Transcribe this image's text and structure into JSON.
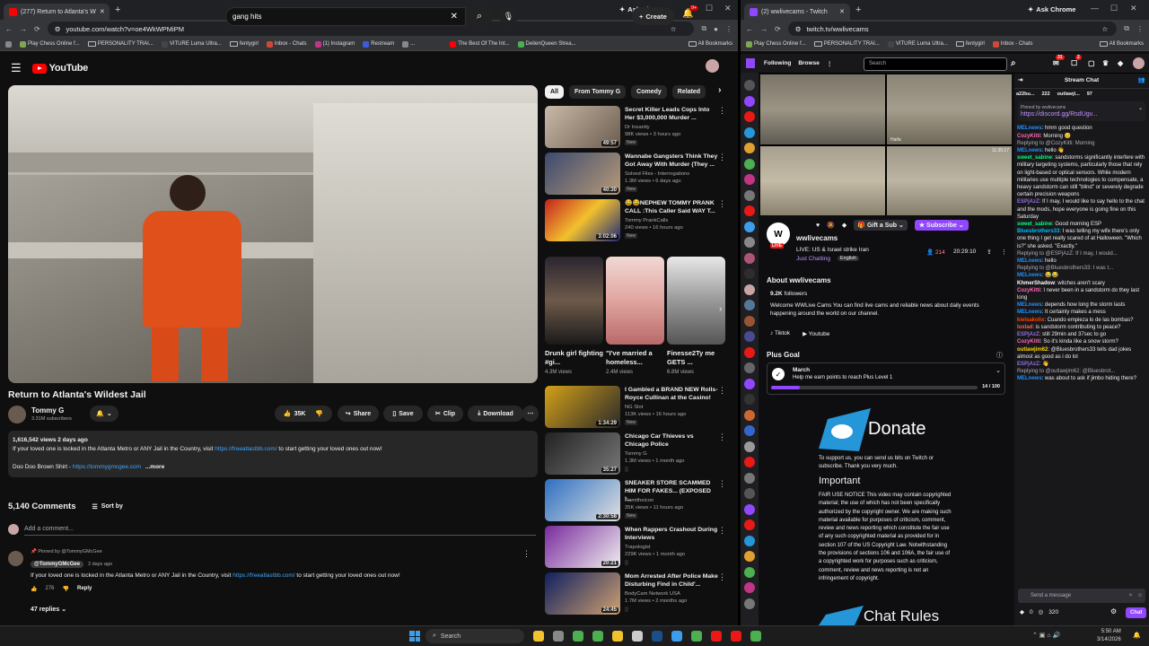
{
  "left_window": {
    "tab_title": "(277) Return to Atlanta's W",
    "url": "youtube.com/watch?v=oe4WkWPMiPM",
    "ask_chrome": "Ask Chrome",
    "bookmarks": [
      "Play Chess Online f...",
      "PERSONALITY TRAI...",
      "VITURE Luma Ultra...",
      "fentygirl",
      "Inbox - Chats",
      "(1) Instagram",
      "Restream",
      "...",
      "The Best Of The Int...",
      "DeilenQueen Strea...",
      "All Bookmarks"
    ]
  },
  "youtube": {
    "logo": "YouTube",
    "search_value": "gang hits",
    "create_label": "Create",
    "notif_count": "9+",
    "video_title": "Return to Atlanta's Wildest Jail",
    "channel_name": "Tommy G",
    "subscribers": "3.31M subscribers",
    "likes": "35K",
    "share": "Share",
    "save": "Save",
    "clip": "Clip",
    "download": "Download",
    "views_date": "1,616,542 views  2 days ago",
    "desc_line1_a": "If your loved one is locked in the Atlanta Metro or ANY Jail in the Country, visit ",
    "desc_link1": "https://freeatlastbb.com/",
    "desc_line1_b": " to start getting your loved ones out now!",
    "desc_line2_a": "Doo Doo Brown Shirt - ",
    "desc_link2": "https://tommygmcgee.com",
    "desc_more": "...more",
    "comments_count": "5,140 Comments",
    "sort_by": "Sort by",
    "add_comment": "Add a comment...",
    "pinned_by": "Pinned by @TommyGMcGee",
    "comment_author": "@TommyGMcGee",
    "comment_time": "2 days ago",
    "comment_text_a": "If your loved one is locked in the Atlanta Metro or ANY Jail in the Country, visit ",
    "comment_link": "https://freeatlastbb.com/",
    "comment_text_b": " to start getting your loved ones out now!",
    "comment_likes": "276",
    "reply": "Reply",
    "replies": "47 replies",
    "chips": [
      "All",
      "From Tommy G",
      "Comedy",
      "Related"
    ],
    "recs": [
      {
        "title": "Secret Killer Leads Cops Into Her $3,000,000 Murder ...",
        "channel": "Dr Insanity",
        "meta": "98K views • 3 hours ago",
        "duration": "49:57",
        "isnew": "New"
      },
      {
        "title": "Wannabe Gangsters Think They Got Away With Murder (They ...",
        "channel": "Solved Files - Interrogations",
        "meta": "1.3M views • 6 days ago",
        "duration": "40:30",
        "isnew": "New"
      },
      {
        "title": "😂😂NEPHEW TOMMY PRANK CALL :This Caller Said WAY T...",
        "channel": "Tommy PrankCalls",
        "meta": "240 views • 16 hours ago",
        "duration": "3:02:06",
        "isnew": "New"
      }
    ],
    "shorts": [
      {
        "title": "Drunk girl fighting #gi...",
        "views": "4.3M views"
      },
      {
        "title": "\"I've married a homeless...",
        "views": "2.4M views"
      },
      {
        "title": "Finesse2Ty me GETS ...",
        "views": "6.8M views"
      }
    ],
    "recs2": [
      {
        "title": "I Gambled a BRAND NEW Rolls-Royce Cullinan at the Casino!",
        "channel": "NG Slot",
        "meta": "113K views • 16 hours ago",
        "duration": "1:34:29",
        "isnew": "New"
      },
      {
        "title": "Chicago Car Thieves vs Chicago Police",
        "channel": "Tommy G",
        "meta": "1.3M views • 1 month ago",
        "duration": "35:27",
        "isnew": ""
      },
      {
        "title": "SNEAKER STORE SCAMMED HIM FOR FAKES... (EXPOSED I...",
        "channel": "Ramitheicon",
        "meta": "35K views • 11 hours ago",
        "duration": "2:30:58",
        "isnew": "New"
      },
      {
        "title": "When Rappers Crashout During Interviews",
        "channel": "Trapologist",
        "meta": "229K views • 1 month ago",
        "duration": "20:21",
        "isnew": ""
      },
      {
        "title": "Mom Arrested After Police Make Disturbing Find in Child'...",
        "channel": "BodyCam Network USA",
        "meta": "1.7M views • 2 months ago",
        "duration": "24:45",
        "isnew": ""
      }
    ]
  },
  "right_window": {
    "tab_title": "(2) wwlivecams - Twitch",
    "url": "twitch.tv/wwlivecams",
    "ask_chrome": "Ask Chrome",
    "bookmarks": [
      "Play Chess Online f...",
      "PERSONALITY TRAI...",
      "VITURE Luma Ultra...",
      "fentygirl",
      "Inbox - Chats",
      "All Bookmarks"
    ]
  },
  "twitch": {
    "following": "Following",
    "browse": "Browse",
    "search_placeholder": "Search",
    "notif1": "31",
    "notif2": "2",
    "cam_labels": [
      "",
      "Haifa",
      "",
      "11:35:17"
    ],
    "gift": "Gift a Sub",
    "subscribe": "Subscribe",
    "channel": "wwlivecams",
    "live": "LIVE",
    "stream_title": "LIVE: US & Israel strike Iran",
    "category": "Just Chatting",
    "language": "English",
    "viewers": "214",
    "uptime": "20:29:10",
    "about": "About wwlivecams",
    "followers": "9.2K",
    "followers_label": "followers",
    "about_text": "Welcome WWLive Cams You can find live cams and reliable news about daily events happening around the world on our channel.",
    "tiktok": "Tiktok",
    "youtube": "Youtube",
    "plus_goal": "Plus Goal",
    "goal_month": "March",
    "goal_text": "Help me earn points to reach Plus Level 1",
    "goal_progress": "14 / 100",
    "donate": "Donate",
    "donate_text": "To support us, you can send us bits on Twitch or subscribe. Thank you very much.",
    "important": "Important",
    "fair_use": "FAIR USE NOTICE This video may contain copyrighted material; the use of which has not been specifically authorized by the copyright owner. We are making such material available for purposes of criticism, comment, review and news reporting which constitute the fair use of any such copyrighted material as provided for in section 107 of the US Copyright Law. Notwithstanding the provisions of sections 106 and 106A, the fair use of a copyrighted work for purposes such as criticism, comment, review and news reporting is not an infringement of copyright.",
    "chat_rules": "Chat Rules",
    "stream_chat": "Stream Chat",
    "pinned_by": "Pinned by wwlivecams",
    "pinned_link": "https://discord.gg/RsdUgv...",
    "chat_top": [
      "a22bu...",
      "222",
      "outlawji...",
      "97"
    ],
    "send_placeholder": "Send a message",
    "points": "0",
    "points2": "320",
    "chat_btn": "Chat",
    "messages": [
      {
        "user": "MELnews",
        "text": ": hmm good question",
        "color": "#1e90ff"
      },
      {
        "user": "CozyKitti",
        "text": ": Morning 😊",
        "color": "#ff69b4"
      },
      {
        "user": "",
        "text": "Replying to @CozyKitti: Morning",
        "color": "#aaaaaa"
      },
      {
        "user": "MELnews",
        "text": ": hello 👋",
        "color": "#1e90ff"
      },
      {
        "user": "sweet_sabine",
        "text": ": sandstorms significantly interfere with military targeting systems, particularly those that rely on light-based or optical sensors. While modern militaries use multiple technologies to compensate, a heavy sandstorm can still \"blind\" or severely degrade certain precision weapons",
        "color": "#00ff7f"
      },
      {
        "user": "ESPjAzZ",
        "text": ": If I may, I would like to say hello to the chat and the mods, hope everyone is going fine on this Saturday",
        "color": "#9370db"
      },
      {
        "user": "sweet_sabine",
        "text": ": Good morning ESP",
        "color": "#00ff7f"
      },
      {
        "user": "Bluesbrothers33",
        "text": ": I was telling my wife there's only one thing I get really scared of at Halloween. \"Which is?\" she asked. \"Exactly.\"",
        "color": "#00bfff"
      },
      {
        "user": "",
        "text": "Replying to @ESPjAzZ: If I may, I would...",
        "color": "#aaaaaa"
      },
      {
        "user": "MELnews",
        "text": ": hello",
        "color": "#1e90ff"
      },
      {
        "user": "",
        "text": "Replying to @Bluesbrothers33: I was t...",
        "color": "#aaaaaa"
      },
      {
        "user": "MELnews",
        "text": ": 😂😂",
        "color": "#1e90ff"
      },
      {
        "user": "KhmerShadow",
        "text": ": witches aren't scary",
        "color": "#ffffff"
      },
      {
        "user": "CozyKitti",
        "text": ": I never been in a sandstorm do they last long",
        "color": "#ff69b4"
      },
      {
        "user": "MELnews",
        "text": ": depends how long the storm lasts",
        "color": "#1e90ff"
      },
      {
        "user": "MELnews",
        "text": ": It certainly makes a mess",
        "color": "#1e90ff"
      },
      {
        "user": "kielsakolix",
        "text": ": Cuando empieza lo de las bombas?",
        "color": "#ff4500"
      },
      {
        "user": "luxlad",
        "text": ": is sandstorm contributing to peace?",
        "color": "#ff6347"
      },
      {
        "user": "ESPjAzZ",
        "text": ": still 29min and 37sec to go",
        "color": "#9370db"
      },
      {
        "user": "CozyKitti",
        "text": ": So it's kinda like a snow storm?",
        "color": "#ff69b4"
      },
      {
        "user": "outlawjim62",
        "text": ": @Bluesbrothers33 tells dad jokes almost as good as i do lol",
        "color": "#ffd700"
      },
      {
        "user": "ESPjAzZ",
        "text": ": 👋",
        "color": "#9370db"
      },
      {
        "user": "",
        "text": "Replying to @outlawjim62: @Bluesbrot...",
        "color": "#aaaaaa"
      },
      {
        "user": "MELnews",
        "text": ": was about to ask if jimbo hiding there?",
        "color": "#1e90ff"
      }
    ]
  },
  "taskbar": {
    "search": "Search",
    "time": "5:50 AM",
    "date": "3/14/2026"
  }
}
